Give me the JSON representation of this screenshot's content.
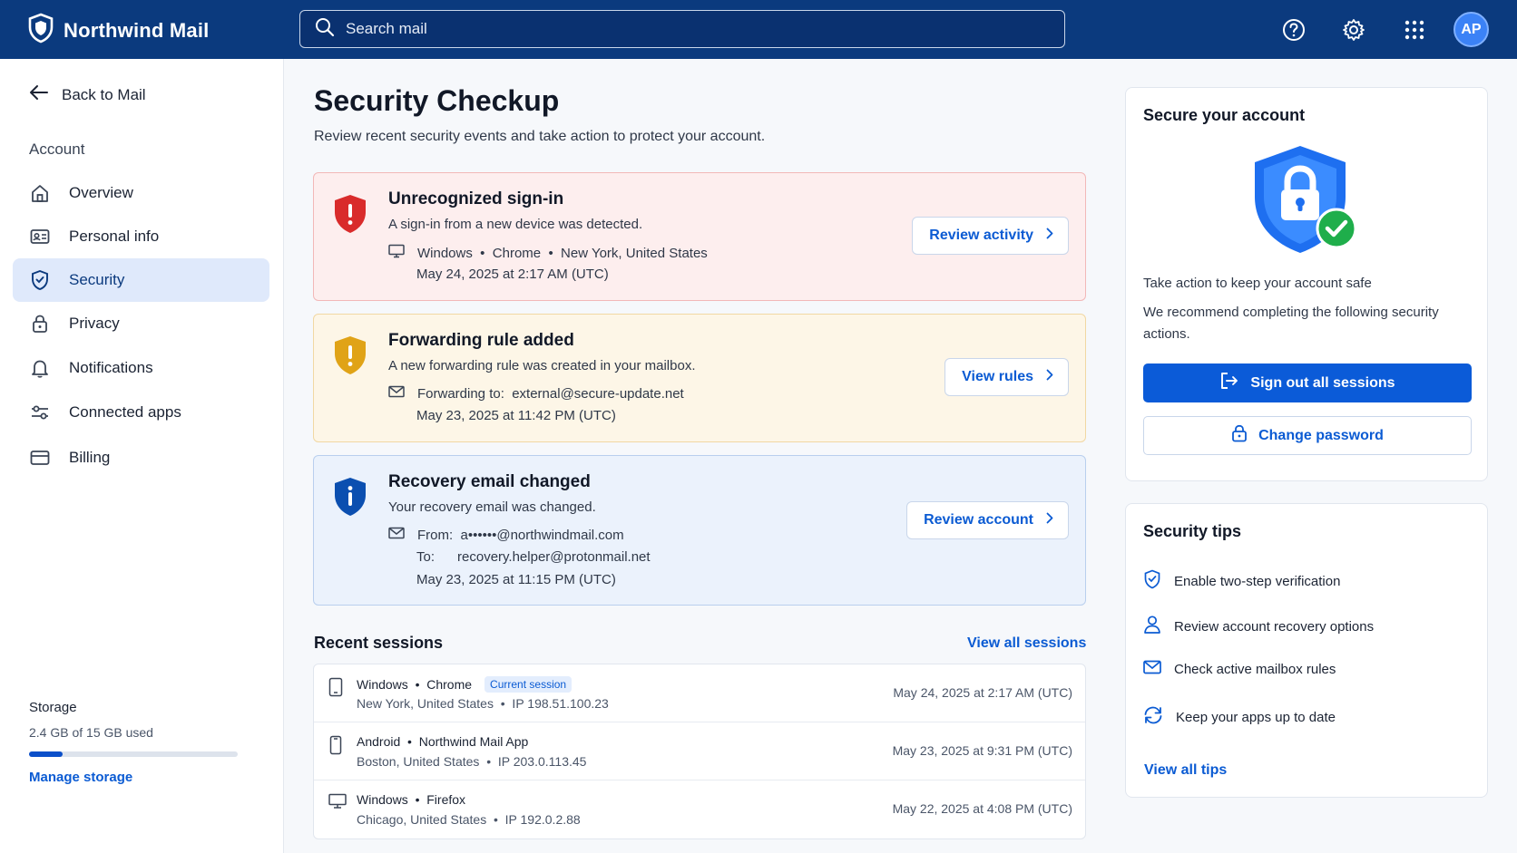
{
  "app": {
    "name": "Northwind Mail",
    "avatar_initials": "AP"
  },
  "search": {
    "placeholder": "Search mail"
  },
  "sidebar": {
    "back_label": "Back to Mail",
    "section_label": "Account",
    "items": [
      {
        "label": "Overview",
        "icon": "home-icon"
      },
      {
        "label": "Personal info",
        "icon": "id-card-icon"
      },
      {
        "label": "Security",
        "icon": "shield-icon",
        "active": true
      },
      {
        "label": "Privacy",
        "icon": "lock-icon"
      },
      {
        "label": "Notifications",
        "icon": "bell-icon"
      },
      {
        "label": "Connected apps",
        "icon": "sliders-icon"
      },
      {
        "label": "Billing",
        "icon": "credit-card-icon"
      }
    ],
    "storage": {
      "title": "Storage",
      "used_text": "2.4 GB of 15 GB used",
      "used_fraction": 0.16,
      "manage_label": "Manage storage"
    }
  },
  "main": {
    "title": "Security Checkup",
    "subtitle": "Review recent security events and take action to protect your account.",
    "events": [
      {
        "title": "Unrecognized sign-in",
        "description": "A sign-in from a new device was detected.",
        "detail_line": "Windows  •  Chrome  •  New York, United States",
        "time": "May 24, 2025 at 2:17 AM (UTC)",
        "button": "Review activity",
        "color": "#d92b2b"
      },
      {
        "title": "Forwarding rule added",
        "description": "A new forwarding rule was created in your mailbox.",
        "detail_line": "Forwarding to:  external@secure-update.net",
        "time": "May 23, 2025 at 11:42 PM (UTC)",
        "button": "View rules",
        "color": "#e0a317"
      },
      {
        "title": "Recovery email changed",
        "description": "Your recovery email was changed.",
        "from_line": "From:  a••••••@northwindmail.com",
        "to_line": "To:      recovery.helper@protonmail.net",
        "time": "May 23, 2025 at 11:15 PM (UTC)",
        "button": "Review account",
        "color": "#0b4fb0"
      }
    ],
    "recent_sessions": {
      "title": "Recent sessions",
      "view_all": "View all sessions",
      "rows": [
        {
          "device": "Windows  •  Chrome",
          "badge": "Current session",
          "location": "New York, United States  •  IP 198.51.100.23",
          "time": "May 24, 2025 at 2:17 AM (UTC)",
          "icon": "tablet-icon"
        },
        {
          "device": "Android  •  Northwind Mail App",
          "location": "Boston, United States  •  IP 203.0.113.45",
          "time": "May 23, 2025 at 9:31 PM (UTC)",
          "icon": "phone-icon"
        },
        {
          "device": "Windows  •  Firefox",
          "location": "Chicago, United States  •  IP 192.0.2.88",
          "time": "May 22, 2025 at 4:08 PM (UTC)",
          "icon": "monitor-icon"
        }
      ]
    }
  },
  "secure_card": {
    "title": "Secure your account",
    "line1": "Take action to keep your account safe",
    "line2": "We recommend completing the following security actions.",
    "primary_button": "Sign out all sessions",
    "secondary_button": "Change password"
  },
  "tips_card": {
    "title": "Security tips",
    "tips": [
      {
        "label": "Enable two-step verification",
        "icon": "shield-check-icon"
      },
      {
        "label": "Review account recovery options",
        "icon": "user-icon"
      },
      {
        "label": "Check active mailbox rules",
        "icon": "mail-icon"
      },
      {
        "label": "Keep your apps up to date",
        "icon": "refresh-icon"
      }
    ],
    "view_all": "View all tips"
  }
}
